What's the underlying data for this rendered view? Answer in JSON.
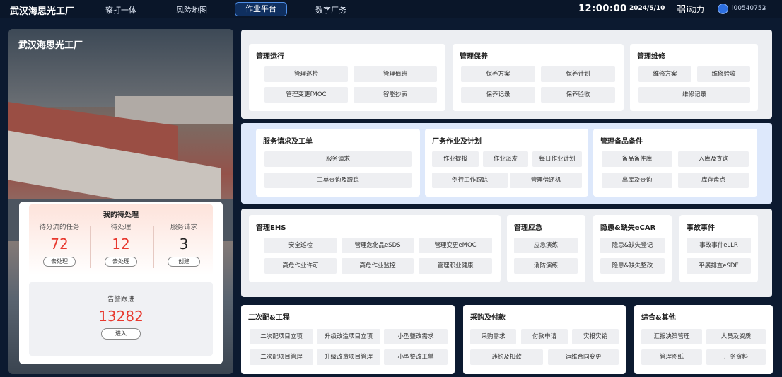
{
  "header": {
    "brand": "武汉海思光工厂",
    "nav": [
      "察打一体",
      "风险地图",
      "作业平台",
      "数字厂务"
    ],
    "active_nav": "作业平台",
    "time": "12:00:00",
    "date": "2024/5/10",
    "dynamic_label": "i动力",
    "user_id": "l00540752",
    "icons": [
      "grid-icon",
      "avatar-icon",
      "chevron-down-icon"
    ]
  },
  "left": {
    "factory_title": "武汉海思光工厂",
    "todo_title": "我的待处理",
    "stats": [
      {
        "label": "待分流的任务",
        "value": "72",
        "button": "去处理"
      },
      {
        "label": "待处理",
        "value": "12",
        "button": "去处理"
      },
      {
        "label": "服务请求",
        "value": "3",
        "button": "创建"
      }
    ],
    "alarm_label": "告警跟进",
    "alarm_value": "13282",
    "alarm_button": "进入"
  },
  "sections": {
    "ops": {
      "title": "管理运行",
      "items": [
        "管理巡检",
        "管理值班",
        "管理变更fMOC",
        "智能抄表"
      ]
    },
    "maint": {
      "title": "管理保养",
      "items": [
        "保养方案",
        "保养计划",
        "保养记录",
        "保养验收"
      ]
    },
    "repair": {
      "title": "管理维修",
      "items": [
        "维修方案",
        "维修验收",
        "维修记录"
      ]
    },
    "service": {
      "title": "服务请求及工单",
      "items": [
        "服务请求",
        "工单查询及跟踪"
      ]
    },
    "plant": {
      "title": "厂务作业及计划",
      "items": [
        "作业提报",
        "作业派发",
        "每日作业计划",
        "例行工作跟踪",
        "管理借还机"
      ]
    },
    "spares": {
      "title": "管理备品备件",
      "items": [
        "备品备件库",
        "入库及查询",
        "出库及查询",
        "库存盘点"
      ]
    },
    "ehs": {
      "title": "管理EHS",
      "items": [
        "安全巡检",
        "管理危化品eSDS",
        "管理变更eMOC",
        "高危作业许可",
        "高危作业监控",
        "管理职业健康"
      ]
    },
    "emergency": {
      "title": "管理应急",
      "items": [
        "应急演练",
        "消防演练"
      ]
    },
    "hazard": {
      "title": "隐患&缺失eCAR",
      "items": [
        "隐患&缺失登记",
        "隐患&缺失整改"
      ]
    },
    "accident": {
      "title": "事故事件",
      "items": [
        "事故事件eLLR",
        "平展排查eSDE"
      ]
    },
    "secondary": {
      "title": "二次配&工程",
      "items": [
        "二次配项目立项",
        "升级改造项目立项",
        "小型整改需求",
        "二次配项目管理",
        "升级改造项目管理",
        "小型整改工单"
      ]
    },
    "purchase": {
      "title": "采购及付款",
      "items": [
        "采购需求",
        "付款申请",
        "实报实销",
        "违约及扣款",
        "运维合同变更"
      ]
    },
    "misc": {
      "title": "综合&其他",
      "items": [
        "汇报决策管理",
        "人员及资质",
        "管理图纸",
        "厂务资料"
      ]
    }
  }
}
